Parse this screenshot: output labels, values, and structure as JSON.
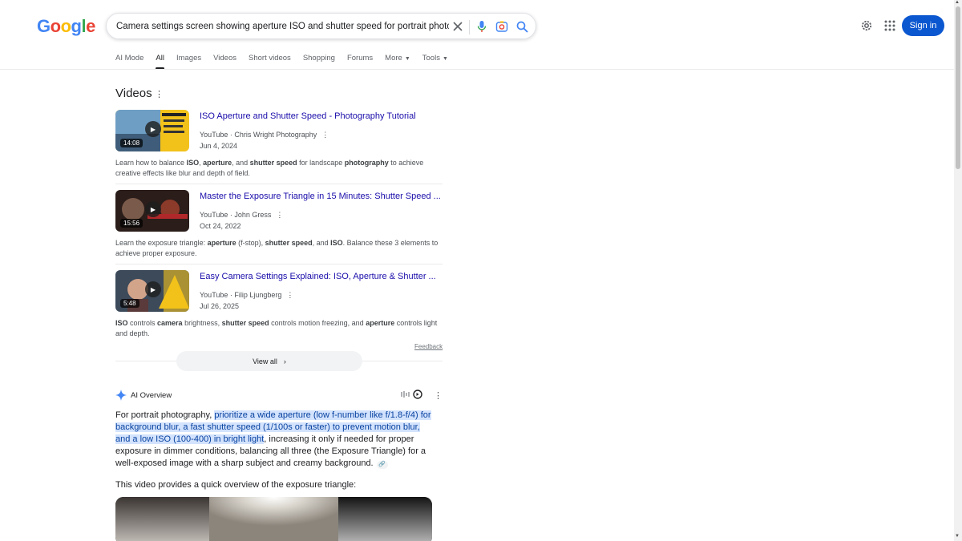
{
  "header": {
    "logo_letters": [
      "G",
      "o",
      "o",
      "g",
      "l",
      "e"
    ],
    "search": {
      "value": "Camera settings screen showing aperture ISO and shutter speed for portrait photography",
      "clear_icon": "close-icon",
      "voice_icon": "microphone-icon",
      "lens_icon": "camera-lens-icon",
      "search_icon": "search-icon"
    },
    "settings_icon": "gear-icon",
    "apps_icon": "apps-grid-icon",
    "signin_label": "Sign in"
  },
  "tabs": [
    {
      "label": "AI Mode",
      "active": false
    },
    {
      "label": "All",
      "active": true
    },
    {
      "label": "Images",
      "active": false
    },
    {
      "label": "Videos",
      "active": false
    },
    {
      "label": "Short videos",
      "active": false
    },
    {
      "label": "Shopping",
      "active": false
    },
    {
      "label": "Forums",
      "active": false
    },
    {
      "label": "More",
      "active": false
    },
    {
      "label": "Tools",
      "active": false
    }
  ],
  "videos": {
    "title": "Videos",
    "items": [
      {
        "title": "ISO Aperture and Shutter Speed - Photography Tutorial",
        "source": "YouTube · Chris Wright Photography",
        "date": "Jun 4, 2024",
        "duration": "14:08",
        "desc_parts": [
          "Learn how to balance ",
          "ISO",
          ", ",
          "aperture",
          ", and ",
          "shutter speed",
          " for landscape ",
          "photography",
          " to achieve creative effects like blur and depth of field."
        ]
      },
      {
        "title": "Master the Exposure Triangle in 15 Minutes: Shutter Speed ...",
        "source": "YouTube · John Gress",
        "date": "Oct 24, 2022",
        "duration": "15:56",
        "desc_parts": [
          "Learn the exposure triangle: ",
          "aperture",
          " (f-stop), ",
          "shutter speed",
          ", and ",
          "ISO",
          ". Balance these 3 elements to achieve proper exposure."
        ]
      },
      {
        "title": "Easy Camera Settings Explained: ISO, Aperture & Shutter ...",
        "source": "YouTube · Filip Ljungberg",
        "date": "Jul 26, 2025",
        "duration": "5:48",
        "desc_parts": [
          "ISO",
          " controls ",
          "camera",
          " brightness, ",
          "shutter speed",
          " controls motion freezing, and ",
          "aperture",
          " controls light and depth."
        ]
      }
    ],
    "feedback": "Feedback",
    "view_all": "View all"
  },
  "ai_overview": {
    "label": "AI Overview",
    "text_before": "For portrait photography, ",
    "text_highlight": "prioritize a wide aperture (low f-number like f/1.8-f/4) for background blur, a fast shutter speed (1/100s or faster) to prevent motion blur, and a low ISO (100-400) in bright light",
    "text_after": ", increasing it only if needed for proper exposure in dimmer conditions, balancing all three (the Exposure Triangle) for a well-exposed image with a sharp subject and creamy background.",
    "video_intro": "This video provides a quick overview of the exposure triangle:"
  }
}
